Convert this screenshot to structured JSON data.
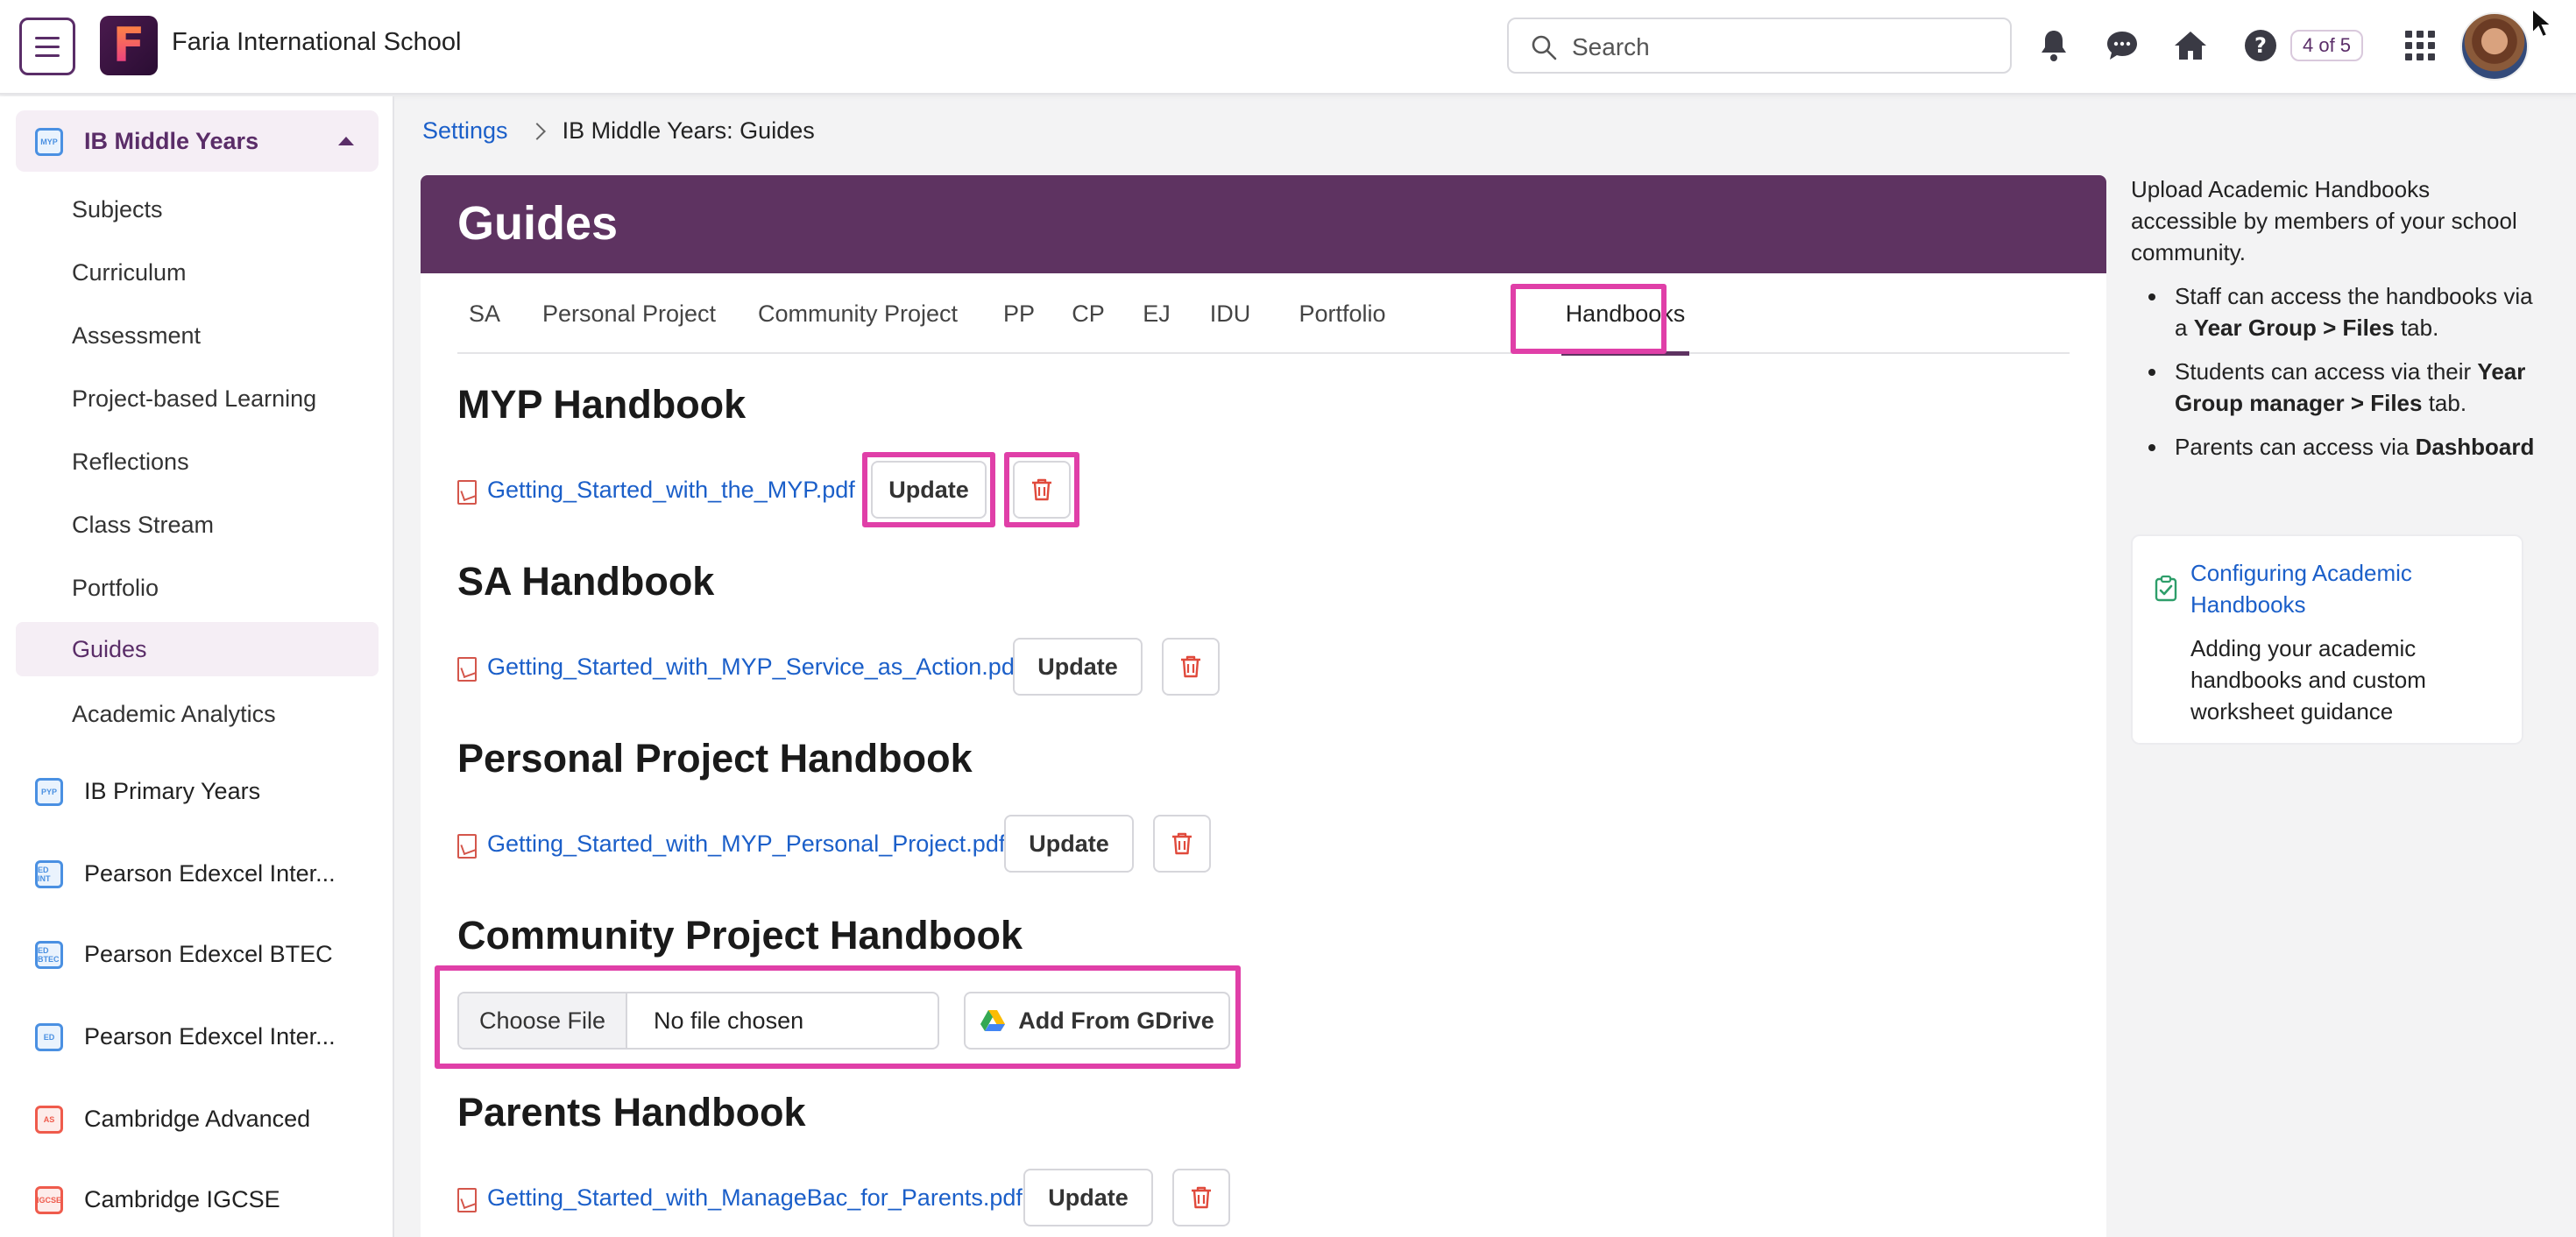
{
  "header": {
    "school_name": "Faria International School",
    "logo_letter": "F",
    "search_placeholder": "Search",
    "page_badge": "4 of 5",
    "accent_color": "#5e3361",
    "highlight_color": "#e03fa8"
  },
  "sidebar": {
    "groups": [
      {
        "label": "IB Middle Years",
        "icon": "MYP",
        "expanded": true
      },
      {
        "label": "IB Primary Years",
        "icon": "PYP"
      },
      {
        "label": "Pearson Edexcel Inter...",
        "icon": "ED INT"
      },
      {
        "label": "Pearson Edexcel BTEC",
        "icon": "ED BTEC"
      },
      {
        "label": "Pearson Edexcel Inter...",
        "icon": "ED"
      },
      {
        "label": "Cambridge Advanced",
        "icon": "AS"
      },
      {
        "label": "Cambridge IGCSE",
        "icon": "IGCSE"
      }
    ],
    "items": [
      "Subjects",
      "Curriculum",
      "Assessment",
      "Project-based Learning",
      "Reflections",
      "Class Stream",
      "Portfolio",
      "Guides",
      "Academic Analytics"
    ],
    "active_item": "Guides"
  },
  "breadcrumb": {
    "parent": "Settings",
    "current": "IB Middle Years: Guides"
  },
  "page": {
    "title": "Guides"
  },
  "tabs": [
    "SA",
    "Personal Project",
    "Community Project",
    "PP",
    "CP",
    "EJ",
    "IDU",
    "Portfolio",
    "Handbooks"
  ],
  "active_tab": "Handbooks",
  "handbooks": [
    {
      "title": "MYP Handbook",
      "file": "Getting_Started_with_the_MYP.pdf",
      "update_label": "Update"
    },
    {
      "title": "SA Handbook",
      "file": "Getting_Started_with_MYP_Service_as_Action.pdf",
      "update_label": "Update"
    },
    {
      "title": "Personal Project Handbook",
      "file": "Getting_Started_with_MYP_Personal_Project.pdf",
      "update_label": "Update"
    },
    {
      "title": "Community Project Handbook",
      "choose_label": "Choose File",
      "no_file_label": "No file chosen",
      "gdrive_label": "Add From GDrive"
    },
    {
      "title": "Parents Handbook",
      "file": "Getting_Started_with_ManageBac_for_Parents.pdf",
      "update_label": "Update"
    }
  ],
  "right_panel": {
    "intro": "Upload Academic Handbooks accessible by members of your school community.",
    "bullets": [
      {
        "pre": "Staff can access the handbooks via a ",
        "bold": "Year Group > Files",
        "post": " tab."
      },
      {
        "pre": "Students can access via their ",
        "bold": "Year Group manager > Files",
        "post": " tab."
      },
      {
        "pre": "Parents can access via ",
        "bold": "Dashboard",
        "post": ""
      }
    ],
    "help_link": "Configuring Academic Handbooks",
    "help_desc": "Adding your academic handbooks and custom worksheet guidance"
  }
}
